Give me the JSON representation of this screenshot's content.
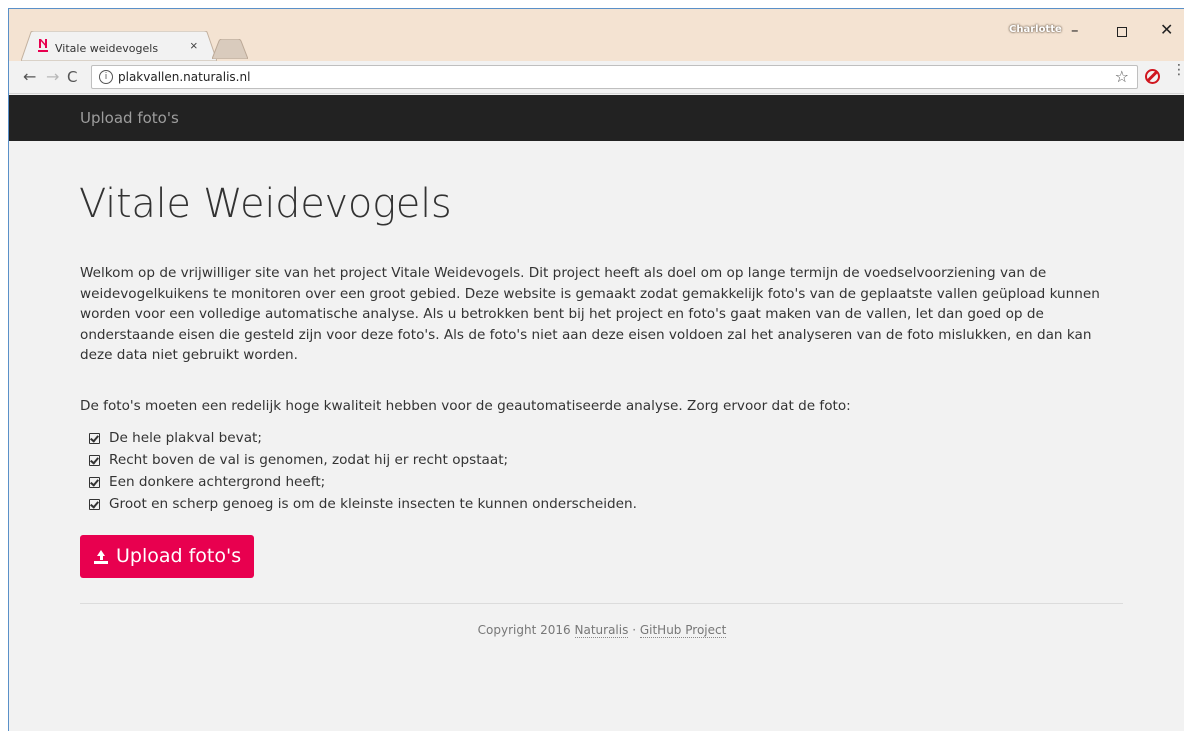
{
  "browser": {
    "tab_title": "Vitale weidevogels",
    "profile_name": "Charlotte",
    "url": "plakvallen.naturalis.nl",
    "accent_favicon": "#e8004f",
    "block_extension_color": "#d0161f"
  },
  "navbar": {
    "link_label": "Upload foto's"
  },
  "main": {
    "title": "Vitale Weidevogels",
    "intro": "Welkom op de vrijwilliger site van het project Vitale Weidevogels. Dit project heeft als doel om op lange termijn de voedselvoorziening van de weidevogelkuikens te monitoren over een groot gebied. Deze website is gemaakt zodat gemakkelijk foto's van de geplaatste vallen geüpload kunnen worden voor een volledige automatische analyse. Als u betrokken bent bij het project en foto's gaat maken van de vallen, let dan goed op de onderstaande eisen die gesteld zijn voor deze foto's. Als de foto's niet aan deze eisen voldoen zal het analyseren van de foto mislukken, en dan kan deze data niet gebruikt worden.",
    "requirements_intro": "De foto's moeten een redelijk hoge kwaliteit hebben voor de geautomatiseerde analyse. Zorg ervoor dat de foto:",
    "requirements": [
      "De hele plakval bevat;",
      "Recht boven de val is genomen, zodat hij er recht opstaat;",
      "Een donkere achtergrond heeft;",
      "Groot en scherp genoeg is om de kleinste insecten te kunnen onderscheiden."
    ],
    "upload_button": "Upload foto's",
    "upload_button_color": "#e8004f"
  },
  "footer": {
    "copyright": "Copyright 2016",
    "naturalis_link": "Naturalis",
    "separator": "·",
    "github_link": "GitHub Project"
  }
}
